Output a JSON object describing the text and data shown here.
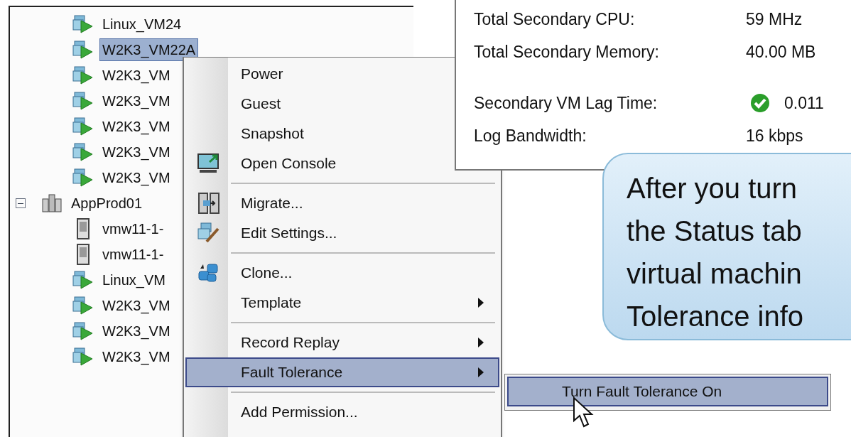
{
  "tree": {
    "items": [
      {
        "kind": "vm",
        "label": "Linux_VM24",
        "selected": false
      },
      {
        "kind": "vm",
        "label": "W2K3_VM22A",
        "selected": true
      },
      {
        "kind": "vm",
        "label": "W2K3_VM",
        "selected": false
      },
      {
        "kind": "vm",
        "label": "W2K3_VM",
        "selected": false
      },
      {
        "kind": "vm",
        "label": "W2K3_VM",
        "selected": false
      },
      {
        "kind": "vm",
        "label": "W2K3_VM",
        "selected": false
      },
      {
        "kind": "vm",
        "label": "W2K3_VM",
        "selected": false
      },
      {
        "kind": "cluster",
        "label": "AppProd01",
        "selected": false,
        "expanded": true,
        "children": [
          {
            "kind": "host",
            "label": "vmw11-1-",
            "selected": false
          },
          {
            "kind": "host",
            "label": "vmw11-1-",
            "selected": false
          },
          {
            "kind": "vm",
            "label": "Linux_VM",
            "selected": false
          },
          {
            "kind": "vm",
            "label": "W2K3_VM",
            "selected": false
          },
          {
            "kind": "vm",
            "label": "W2K3_VM",
            "selected": false
          },
          {
            "kind": "vm",
            "label": "W2K3_VM",
            "selected": false
          }
        ]
      }
    ]
  },
  "context_menu": {
    "items": [
      {
        "kind": "plain",
        "label": "Power",
        "submenu": false,
        "selected": false
      },
      {
        "kind": "plain",
        "label": "Guest",
        "submenu": false,
        "selected": false
      },
      {
        "kind": "plain",
        "label": "Snapshot",
        "submenu": false,
        "selected": false
      },
      {
        "kind": "console",
        "label": "Open Console",
        "submenu": false,
        "selected": false
      },
      {
        "kind": "separator"
      },
      {
        "kind": "migrate",
        "label": "Migrate...",
        "submenu": false,
        "selected": false
      },
      {
        "kind": "edit",
        "label": "Edit Settings...",
        "submenu": false,
        "selected": false
      },
      {
        "kind": "separator"
      },
      {
        "kind": "clone",
        "label": "Clone...",
        "submenu": false,
        "selected": false
      },
      {
        "kind": "plain",
        "label": "Template",
        "submenu": true,
        "selected": false
      },
      {
        "kind": "separator"
      },
      {
        "kind": "plain",
        "label": "Record Replay",
        "submenu": true,
        "selected": false
      },
      {
        "kind": "plain",
        "label": "Fault Tolerance",
        "submenu": true,
        "selected": true
      },
      {
        "kind": "separator"
      },
      {
        "kind": "plain",
        "label": "Add Permission...",
        "submenu": false,
        "selected": false
      }
    ]
  },
  "submenu": {
    "items": [
      {
        "label": "Turn Fault Tolerance On",
        "selected": true
      }
    ]
  },
  "status_panel": {
    "rows": [
      {
        "label": "Total Secondary CPU:",
        "value": "59 MHz",
        "ok": false
      },
      {
        "label": "Total Secondary Memory:",
        "value": "40.00 MB",
        "ok": false
      },
      {
        "label": "Secondary VM Lag Time:",
        "value": "0.011",
        "ok": true
      },
      {
        "label": "Log Bandwidth:",
        "value": "16 kbps",
        "ok": false
      }
    ]
  },
  "callout": {
    "lines": [
      "After you turn",
      "the Status tab",
      "virtual machin",
      "Tolerance info"
    ]
  }
}
